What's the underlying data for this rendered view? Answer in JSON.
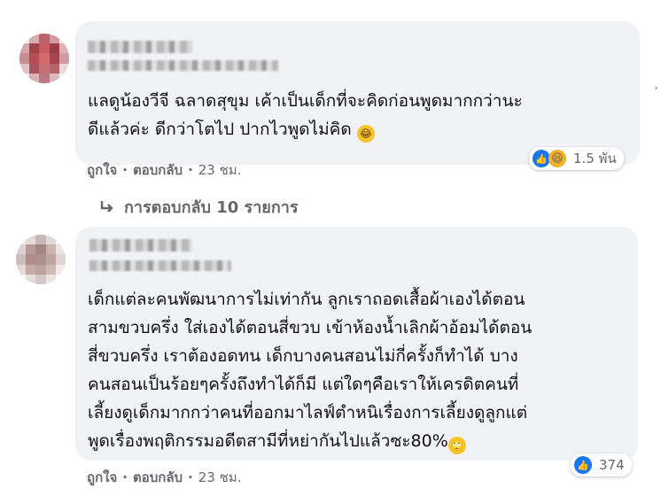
{
  "comments": [
    {
      "text": "แลดูน้องวีจี ฉลาดสุขุม เค้าเป็นเด็กที่จะคิดก่อนพูดมากกว่านะ\nดีแล้วค่ะ ดีกว่าโตไป ปากไวพูดไม่คิด",
      "emoji": "😂",
      "like_label": "ถูกใจ",
      "reply_label": "ตอบกลับ",
      "time": "23 ชม.",
      "reaction_count": "1.5 พัน",
      "reactions": [
        "like-icon",
        "haha-icon"
      ]
    },
    {
      "text": "เด็กแต่ละคนพัฒนาการไม่เท่ากัน ลูกเราถอดเสื้อผ้าเองได้ตอน\nสามขวบครึ่ง ใส่เองได้ตอนสี่ขวบ เข้าห้องน้ำเลิกผ้าอ้อมได้ตอน\nสี่ขวบครึ่ง เราต้องอดทน เด็กบางคนสอนไม่กี่ครั้งก็ทำได้ บาง\nคนสอนเป็นร้อยๆครั้งถึงทำได้ก็มี แต่ใดๆคือเราให้เครดิตคนที่\nเลี้ยงดูเด็กมากกว่าคนที่ออกมาไลฟ์ตำหนิเรื่องการเลี้ยงดูลูกแต่\nพูดเรื่องพฤติกรรมอดีตสามีที่หย่ากันไปแล้วซะ80%",
      "emoji": "🙄",
      "like_label": "ถูกใจ",
      "reply_label": "ตอบกลับ",
      "time": "23 ชม.",
      "reaction_count": "374",
      "reactions": [
        "like-icon"
      ]
    }
  ],
  "replies_link": "การตอบกลับ 10 รายการ",
  "separator": "·",
  "colors": {
    "bubble": "#f0f2f5",
    "meta": "#65676b",
    "like": "#1877f2",
    "haha": "#f7b125"
  }
}
